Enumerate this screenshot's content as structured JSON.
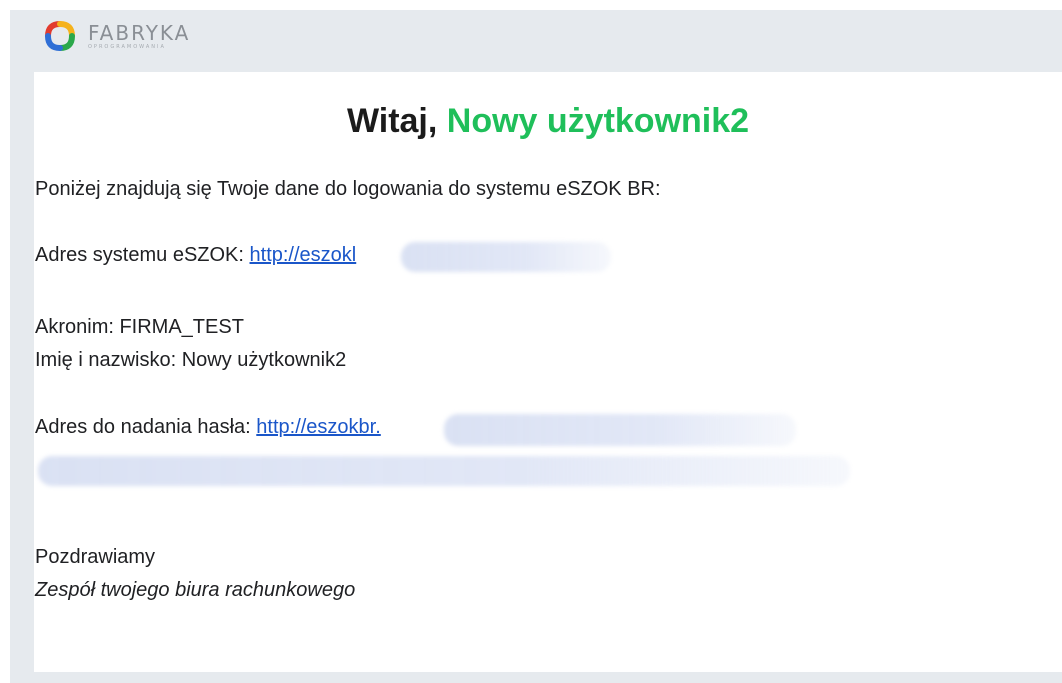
{
  "logo": {
    "title": "FABRYKA",
    "subtitle": "OPROGRAMOWANIA",
    "icon": "fabryka-logo-icon"
  },
  "email": {
    "greeting_prefix": "Witaj, ",
    "greeting_name": "Nowy użytkownik2",
    "intro": "Poniżej znajdują się Twoje dane do logowania do systemu eSZOK BR:",
    "system_address_label": "Adres systemu eSZOK: ",
    "system_address_link": "http://eszokl",
    "acronym_line": "Akronim: FIRMA_TEST",
    "name_line": "Imię i nazwisko: Nowy użytkownik2",
    "password_address_label": "Adres do nadania hasła: ",
    "password_address_link": "http://eszokbr.",
    "closing": "Pozdrawiamy",
    "signature": "Zespół twojego biura rachunkowego"
  },
  "colors": {
    "accent_green": "#1fbf5a",
    "link_blue": "#1a56c9",
    "frame_gray": "#e6eaee"
  }
}
